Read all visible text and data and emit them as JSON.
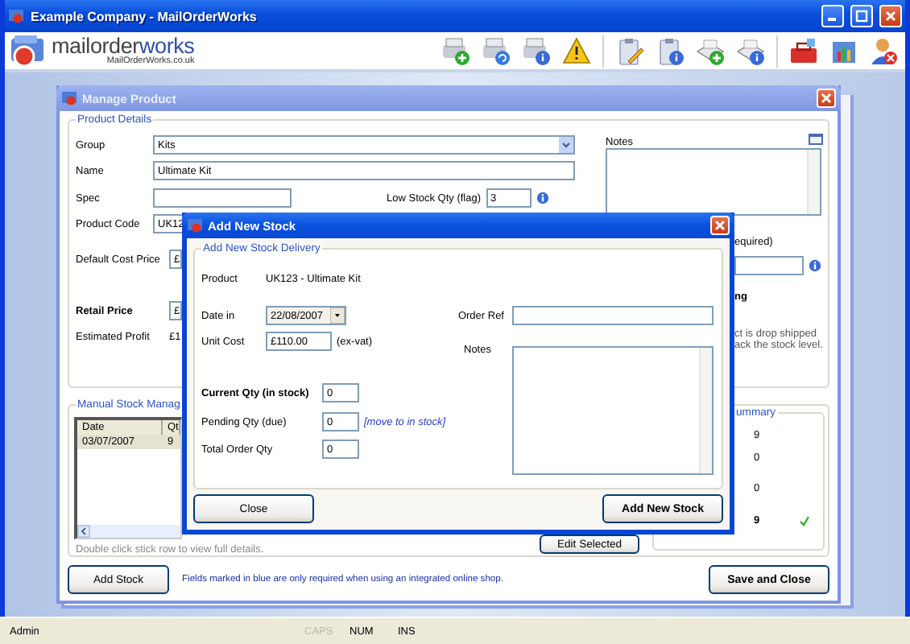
{
  "app_window": {
    "title": "Example Company - MailOrderWorks"
  },
  "logo": {
    "wordmark_dark": "mailorder",
    "wordmark_accent": "works",
    "url": "MailOrderWorks.co.uk"
  },
  "manage_product": {
    "title": "Manage Product",
    "product_details": {
      "legend": "Product Details",
      "group": {
        "label": "Group",
        "value": "Kits"
      },
      "name": {
        "label": "Name",
        "value": "Ultimate Kit"
      },
      "spec": {
        "label": "Spec"
      },
      "low_stock": {
        "label": "Low Stock Qty (flag)",
        "value": "3"
      },
      "product_code": {
        "label": "Product Code",
        "value": "UK12"
      },
      "default_cost": {
        "label": "Default Cost Price",
        "value": "£"
      },
      "retail_price": {
        "label": "Retail Price",
        "value": "£"
      },
      "estimated_profit": {
        "label": "Estimated Profit",
        "value": "£1"
      },
      "notes": {
        "label": "Notes"
      },
      "required_hint": "equired)",
      "drop_ship": {
        "title": "ng",
        "line_1": "ct is drop shipped",
        "line_2": "ack the stock level."
      }
    },
    "manual_stock": {
      "legend": "Manual Stock Manag",
      "columns": [
        "Date",
        "Qt"
      ],
      "rows": [
        {
          "cells": [
            "03/07/2007",
            "9"
          ],
          "selected": true
        }
      ],
      "hint": "Double click stick row to view full details.",
      "edit_button": "Edit Selected"
    },
    "stock_summary": {
      "legend": "ummary",
      "values": [
        {
          "text": "9",
          "bold": false,
          "ok": false
        },
        {
          "text": "0",
          "bold": false,
          "ok": false
        },
        {
          "text": "0",
          "bold": false,
          "ok": false
        },
        {
          "text": "9",
          "bold": true,
          "ok": true
        }
      ]
    },
    "add_stock_button": "Add Stock",
    "blue_note": "Fields marked in blue are only required when using an integrated online shop.",
    "save_button": "Save and Close"
  },
  "add_new_stock": {
    "title": "Add New Stock",
    "legend": "Add New Stock Delivery",
    "product": {
      "label": "Product",
      "value": "UK123 - Ultimate Kit"
    },
    "date_in": {
      "label": "Date in",
      "value": "22/08/2007"
    },
    "unit_cost": {
      "label": "Unit Cost",
      "value": "£110.00",
      "suffix": "(ex-vat)"
    },
    "current_qty": {
      "label": "Current Qty (in stock)",
      "value": "0"
    },
    "pending_qty": {
      "label": "Pending Qty (due)",
      "value": "0",
      "link": "[move to in stock]"
    },
    "total_qty": {
      "label": "Total Order Qty",
      "value": "0"
    },
    "order_ref": {
      "label": "Order Ref"
    },
    "notes": {
      "label": "Notes"
    },
    "close_button": "Close",
    "add_button": "Add New Stock"
  },
  "status_bar": [
    {
      "text": "Admin",
      "disabled": false
    },
    {
      "text": "CAPS",
      "disabled": true
    },
    {
      "text": "NUM",
      "disabled": false
    },
    {
      "text": "INS",
      "disabled": false
    }
  ]
}
